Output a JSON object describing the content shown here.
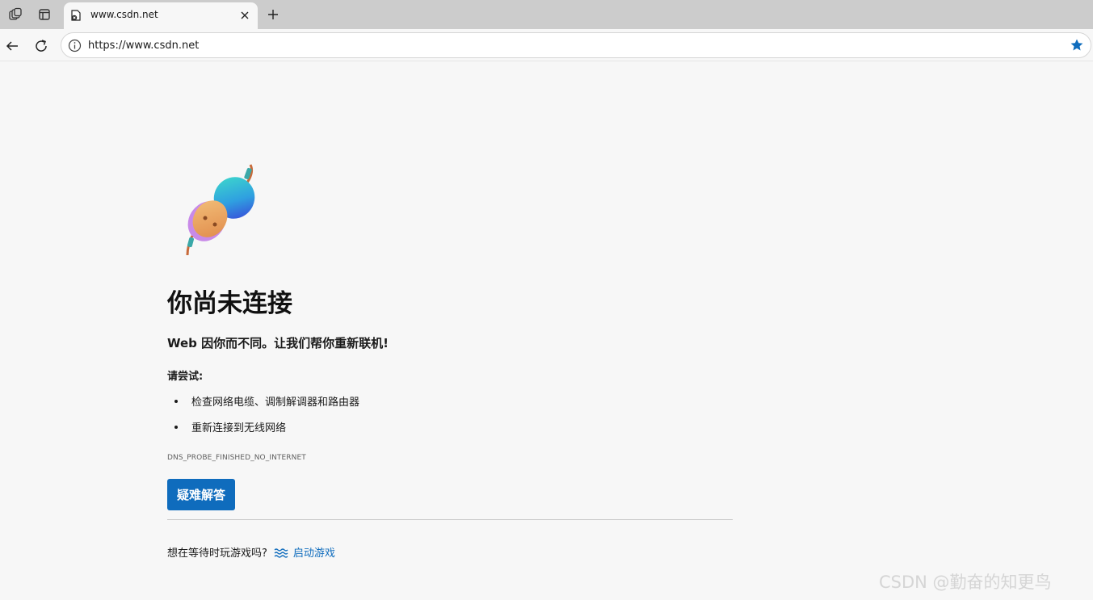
{
  "browser": {
    "tab": {
      "title": "www.csdn.net",
      "favicon": "csdn-favicon-icon"
    },
    "address_bar": {
      "url": "https://www.csdn.net"
    },
    "icons": {
      "workspaces": "workspaces-icon",
      "tab_actions": "tab-actions-icon",
      "close": "close-icon",
      "new_tab": "plus-icon",
      "back": "back-arrow-icon",
      "refresh": "refresh-icon",
      "site_info": "info-icon",
      "favorite": "star-icon"
    },
    "colors": {
      "tabstrip": "#cccccc",
      "page_bg": "#f7f7f7",
      "favorite_star": "#0f6cbd"
    }
  },
  "error_page": {
    "headline": "你尚未连接",
    "subhead": "Web 因你而不同。让我们帮你重新联机!",
    "try_label": "请尝试:",
    "suggestions": [
      "检查网络电缆、调制解调器和路由器",
      "重新连接到无线网络"
    ],
    "error_code": "DNS_PROBE_FINISHED_NO_INTERNET",
    "troubleshoot_button": "疑难解答",
    "game_prompt": "想在等待时玩游戏吗?",
    "game_link": "启动游戏",
    "illustration": "unplugged-cable-icon",
    "colors": {
      "button": "#0f6cbd",
      "link": "#0f6cbd"
    }
  },
  "watermark": "CSDN @勤奋的知更鸟"
}
